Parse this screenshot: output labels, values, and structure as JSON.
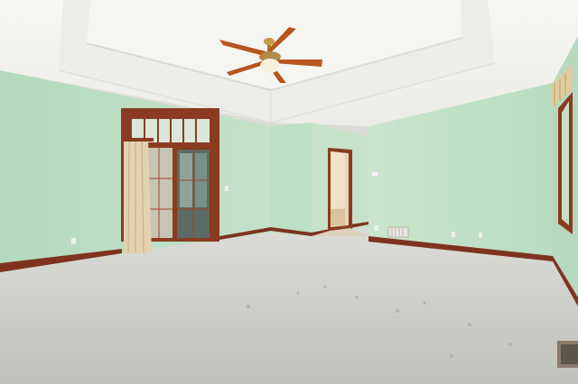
{
  "scene": {
    "description_colors": {
      "wall_green": "#bfe0c6",
      "ceiling": "#f3f3ef",
      "carpet": "#c9cac6",
      "wood_trim": "#8a3a22",
      "curtain": "#e2cfb0"
    },
    "watermark": ""
  }
}
